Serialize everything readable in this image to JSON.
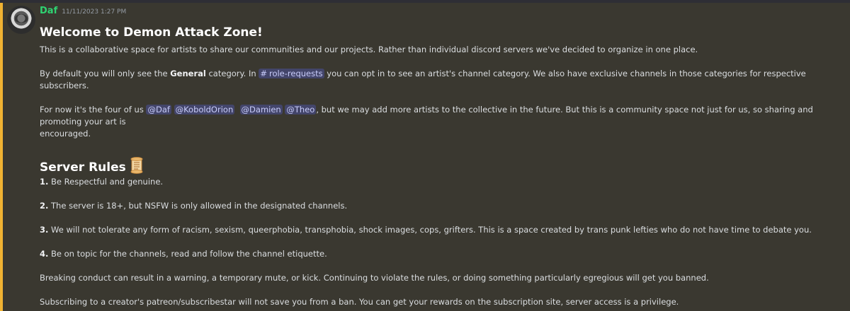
{
  "message": {
    "author": "Daf",
    "timestamp": "11/11/2023 1:27 PM",
    "welcome_title": "Welcome to Demon Attack Zone!",
    "intro": "This is a collaborative space for artists to share our communities and our projects. Rather than individual discord servers we've decided to organize in one place.",
    "default": {
      "pre": "By default you will only see the ",
      "bold": "General",
      "mid": " category. In ",
      "channel_hash": "#",
      "channel_name": "role-requests",
      "post": " you can opt in to see an artist's channel category. We also have exclusive channels in those categories for respective subscribers."
    },
    "artists": {
      "pre": "For now it's the four of us ",
      "mention1": "@Daf",
      "mention2": "@KoboldOrion",
      "mention3": "@Damien",
      "mention4": "@Theo",
      "post_line1": ", but we may add more artists to the collective in the future. But this is a community space not just for us, so sharing and promoting your art is",
      "post_line2": "encouraged."
    },
    "rules_title": "Server Rules",
    "rules_icon": "scroll-emoji",
    "rules": [
      {
        "num": "1.",
        "text": " Be Respectful and genuine."
      },
      {
        "num": "2.",
        "text": " The server is 18+, but NSFW is only allowed in the designated channels."
      },
      {
        "num": "3.",
        "text": " We will not tolerate any form of racism, sexism, queerphobia, transphobia, shock images, cops, grifters. This is a space created by trans punk lefties who do not have time to debate you."
      },
      {
        "num": "4.",
        "text": " Be on topic for the channels, read and follow the channel etiquette."
      }
    ],
    "conduct": "Breaking conduct can result in a warning, a temporary mute, or kick. Continuing to violate the rules, or doing something particularly egregious will get you banned.",
    "subscribing": "Subscribing to a creator's patreon/subscribestar will not save you from a ban. You can get your rewards on the subscription site, server access is a privilege."
  },
  "colors": {
    "background": "#3a3830",
    "mention_highlight_bar": "#f0b232",
    "author_name": "#2fd372",
    "mention_text": "#c9cdfb"
  }
}
